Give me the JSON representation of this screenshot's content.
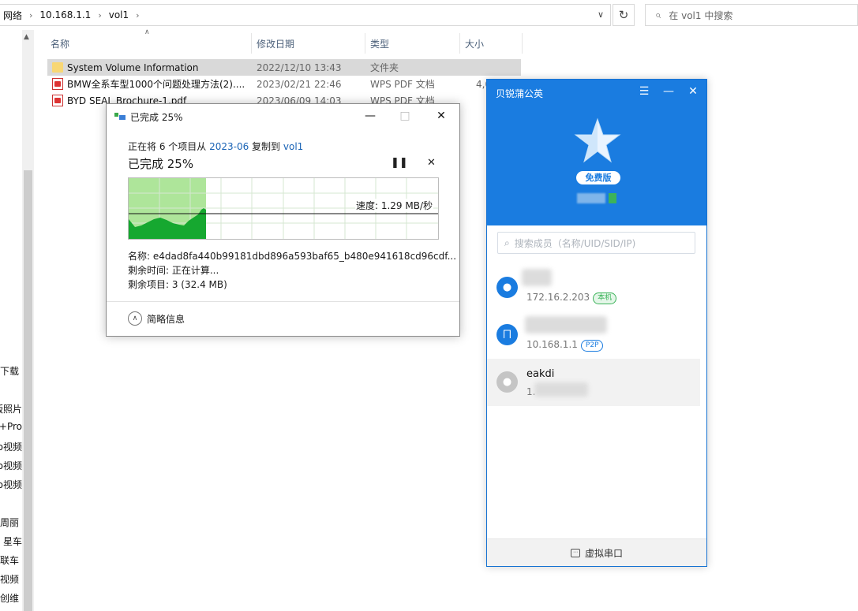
{
  "explorer": {
    "breadcrumb": [
      "网络",
      "10.168.1.1",
      "vol1"
    ],
    "search_placeholder": "在 vol1 中搜索",
    "columns": {
      "name": "名称",
      "date": "修改日期",
      "type": "类型",
      "size": "大小"
    },
    "files": [
      {
        "icon": "folder-icon",
        "name": "System Volume Information",
        "date": "2022/12/10 13:43",
        "type": "文件夹",
        "size": ""
      },
      {
        "icon": "pdf-icon",
        "name": "BMW全系车型1000个问题处理方法(2)....",
        "date": "2023/02/21 22:46",
        "type": "WPS PDF 文档",
        "size": "4,0"
      },
      {
        "icon": "pdf-icon",
        "name": "BYD SEAL Brochure-1.pdf",
        "date": "2023/06/09 14:03",
        "type": "WPS PDF 文档",
        "size": ""
      }
    ],
    "nav_items": [
      "下载",
      "版照片",
      "Pro+",
      "ro视频",
      "ro视频",
      "ro视频",
      "周丽",
      "星车 |",
      "联车",
      "视频",
      "创维"
    ]
  },
  "copy_dialog": {
    "title": "已完成 25%",
    "line_prefix": "正在将 6 个项目从 ",
    "source": "2023-06",
    "line_mid": " 复制到 ",
    "dest": "vol1",
    "progress_text": "已完成 25%",
    "progress_percent": 25,
    "speed": "速度: 1.29 MB/秒",
    "name_line": "名称: e4dad8fa440b99181dbd896a593baf65_b480e941618cd96cdf...",
    "time_line": "剩余时间: 正在计算...",
    "items_line": "剩余项目: 3 (32.4 MB)",
    "less_details": "简略信息"
  },
  "vpn_app": {
    "title": "贝锐蒲公英",
    "badge": "免费版",
    "search_placeholder": "搜索成员（名称/UID/SID/IP)",
    "members": [
      {
        "name": "",
        "ip": "172.16.2.203",
        "tag": "本机",
        "tag_color": "green",
        "avatar": "person-icon"
      },
      {
        "name": "",
        "ip": "10.168.1.1",
        "tag": "P2P",
        "tag_color": "blue",
        "avatar": "router-icon"
      },
      {
        "name": "eakdi",
        "ip": "1.",
        "tag": "",
        "tag_color": "",
        "avatar": "person-icon"
      }
    ],
    "footer": "虚拟串口",
    "colors": {
      "header": "#1a7ce0",
      "accent": "#1a7ce0",
      "online": "#3cb35a"
    }
  }
}
